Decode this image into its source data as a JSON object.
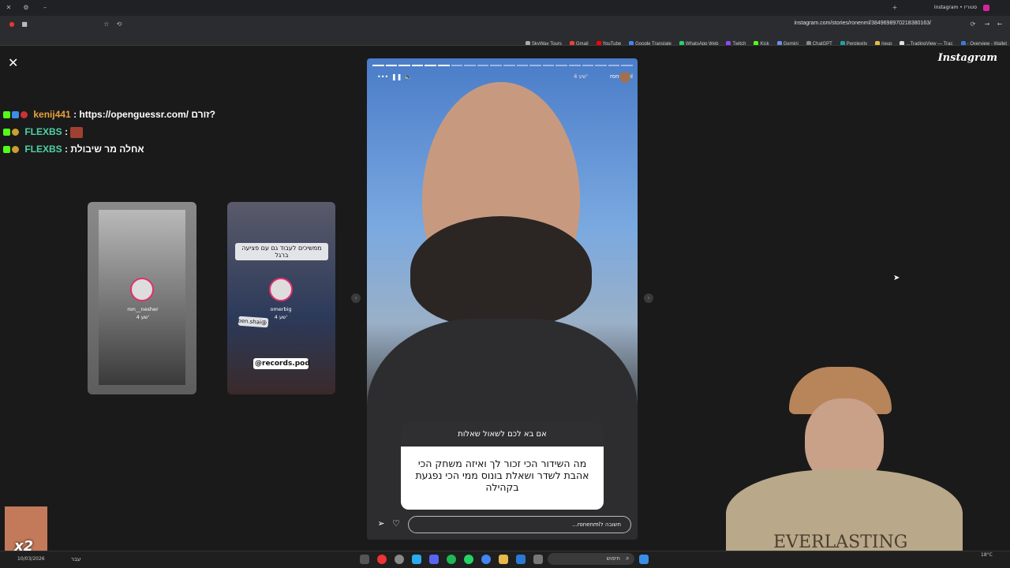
{
  "browser": {
    "url": "instagram.com/stories/ronenml/3849698970218380163/",
    "tab_title": "Instagram • סטוריז"
  },
  "bookmarks": [
    {
      "label": "Overview - Wallet -",
      "color": "#3a7bd5"
    },
    {
      "label": "TradingView — Trac...",
      "color": "#e0e0e0"
    },
    {
      "label": "rieup",
      "color": "#e8b84a"
    },
    {
      "label": "Perplexity",
      "color": "#20a0a0"
    },
    {
      "label": "ChatGPT",
      "color": "#888"
    },
    {
      "label": "Gemini",
      "color": "#6a8ee8"
    },
    {
      "label": "Kick",
      "color": "#53fc18"
    },
    {
      "label": "Twitch",
      "color": "#9146ff"
    },
    {
      "label": "WhatsApp Web",
      "color": "#25d366"
    },
    {
      "label": "Google Translate",
      "color": "#4285f4"
    },
    {
      "label": "YouTube",
      "color": "#ff0000"
    },
    {
      "label": "Gmail",
      "color": "#ea4335"
    },
    {
      "label": "SkyWay Tours",
      "color": "#aaa"
    }
  ],
  "instagram_logo": "Instagram",
  "chat": [
    {
      "user": "kenij441",
      "user_color": "#e8a23a",
      "message": ": https://openguessr.com/ זורם?"
    },
    {
      "user": "FLEXBS",
      "user_color": "#4fd1a5",
      "message": ":"
    },
    {
      "user": "FLEXBS",
      "user_color": "#4fd1a5",
      "message": ": אחלה מר שיבולת"
    }
  ],
  "previews": [
    {
      "caption": "",
      "username": "ron__nesher",
      "time": "4 שע'"
    },
    {
      "caption": "ממשיכים לעבוד גם עם פציעה ברגל",
      "username": "omerbig",
      "time": "4 שע'",
      "tag1": "@ben.shai",
      "tag2": "@records.pod"
    }
  ],
  "story": {
    "username": "ronenml",
    "time": "4 שע'",
    "progress_segments": 20,
    "progress_done": 6,
    "question_title": "אם בא לכם לשאול שאלות",
    "question_answer": "מה השידור הכי זכור לך ואיזה משחק הכי אהבת לשדר  ושאלת בונוס ממי הכי נפגעת בקהילה",
    "reply_placeholder": "תשובה לronenml..."
  },
  "taskbar": {
    "search_placeholder": "חיפוש",
    "lang": "עבר",
    "date": "10/03/2026",
    "weather": "18°C"
  },
  "emote_multiplier": "x2"
}
